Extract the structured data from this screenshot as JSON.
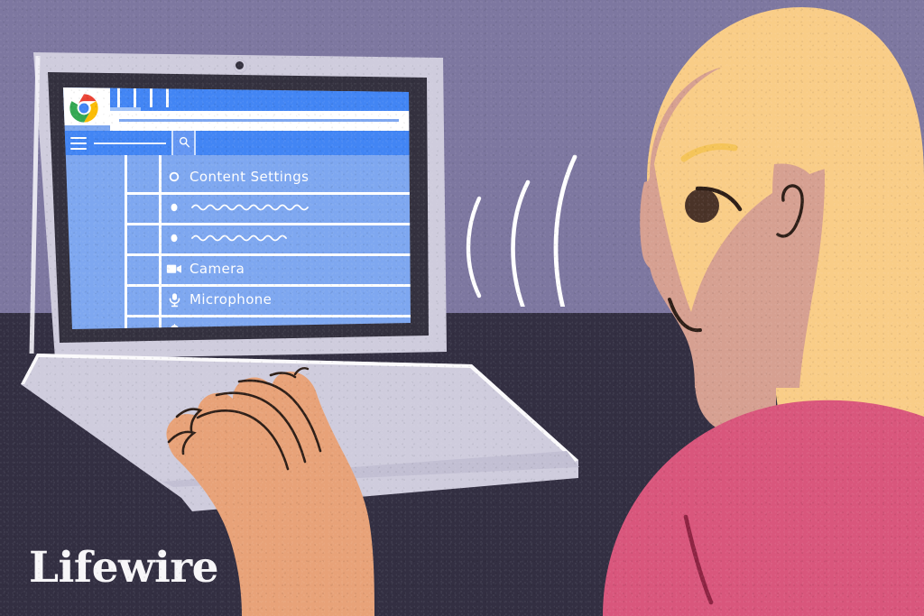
{
  "scene": {
    "title": "Woman at laptop viewing Chrome Content Settings",
    "publisher": "Lifewire",
    "colors": {
      "wall": "#7d77a0",
      "desk": "#332f42",
      "laptop_body": "#cfccdd",
      "bezel": "#34313f",
      "screen_bg": "#7ea7f0",
      "chrome_blue": "#4285f4",
      "skin": "#e8a278",
      "face": "#d6a091",
      "hair": "#f9cd87",
      "shirt": "#d9567c",
      "shirt_fold": "#8e2443",
      "eye": "#4a3328",
      "white": "#ffffff"
    }
  },
  "laptop": {
    "name": "laptop-computer",
    "webcam_label": "webcam",
    "keyboard_label": "keyboard-deck",
    "key_row_count": 5
  },
  "browser": {
    "name": "chrome-browser-window",
    "logo_label": "chrome-logo",
    "tab_count": 4,
    "omnibox": {
      "name": "address-bar",
      "value": "",
      "placeholder": ""
    },
    "toolbar": {
      "menu_label": "menu",
      "search_label": "search"
    }
  },
  "settings_page": {
    "heading_icon": "gear-outline-icon",
    "rows": [
      {
        "icon": "gear-outline-icon",
        "label": "Content Settings",
        "redacted": false
      },
      {
        "icon": "dot-icon",
        "label": "",
        "redacted": true
      },
      {
        "icon": "dot-icon",
        "label": "",
        "redacted": true
      },
      {
        "icon": "camera-icon",
        "label": "Camera",
        "redacted": false
      },
      {
        "icon": "microphone-icon",
        "label": "Microphone",
        "redacted": false
      },
      {
        "icon": "bell-icon",
        "label": "",
        "redacted": true
      }
    ]
  },
  "audio": {
    "name": "sound-waves",
    "arc_count": 3,
    "meaning": "voice input toward microphone"
  },
  "person": {
    "name": "seated-user",
    "hair_color": "#f9cd87",
    "shirt_color": "#d9567c",
    "expression": "smiling"
  },
  "branding": {
    "wordmark": "Lifewire"
  }
}
